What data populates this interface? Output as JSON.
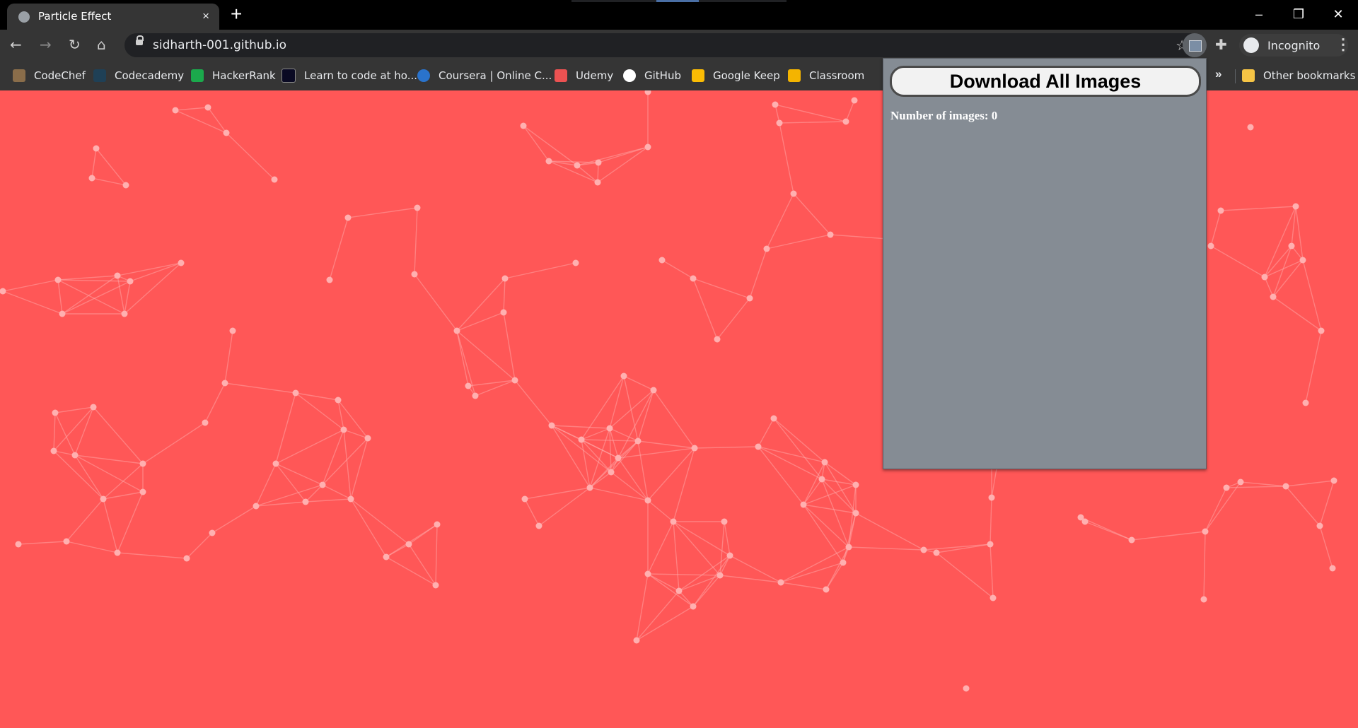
{
  "browser": {
    "tab_title": "Particle Effect",
    "tab_close_icon": "×",
    "new_tab_icon": "+",
    "window_controls": [
      "–",
      "❐",
      "✕"
    ],
    "url": "sidharth-001.github.io",
    "incognito_label": "Incognito"
  },
  "bookmarks": {
    "items": [
      {
        "label": "CodeChef",
        "icon": "codechef-icon",
        "color": "#8a6d4a"
      },
      {
        "label": "Codecademy",
        "icon": "codecademy-icon",
        "color": "#1f4056"
      },
      {
        "label": "HackerRank",
        "icon": "hackerrank-icon",
        "color": "#1ba94c"
      },
      {
        "label": "Learn to code at ho...",
        "icon": "freecodecamp-icon",
        "color": "#0a0a23"
      },
      {
        "label": "Coursera | Online C...",
        "icon": "coursera-icon",
        "color": "#2a73cc"
      },
      {
        "label": "Udemy",
        "icon": "udemy-icon",
        "color": "#ec5252"
      },
      {
        "label": "GitHub",
        "icon": "github-icon",
        "color": "#ffffff"
      },
      {
        "label": "Google Keep",
        "icon": "keep-icon",
        "color": "#fbbc04"
      },
      {
        "label": "Classroom",
        "icon": "classroom-icon",
        "color": "#f4b400"
      }
    ],
    "more_label": "»",
    "other_label": "Other bookmarks"
  },
  "popup": {
    "download_button": "Download All Images",
    "count_text": "Number of images: 0"
  },
  "colors": {
    "page_background": "#ff5757",
    "particle": "#ffaaaa",
    "popup_background": "#858c94"
  }
}
